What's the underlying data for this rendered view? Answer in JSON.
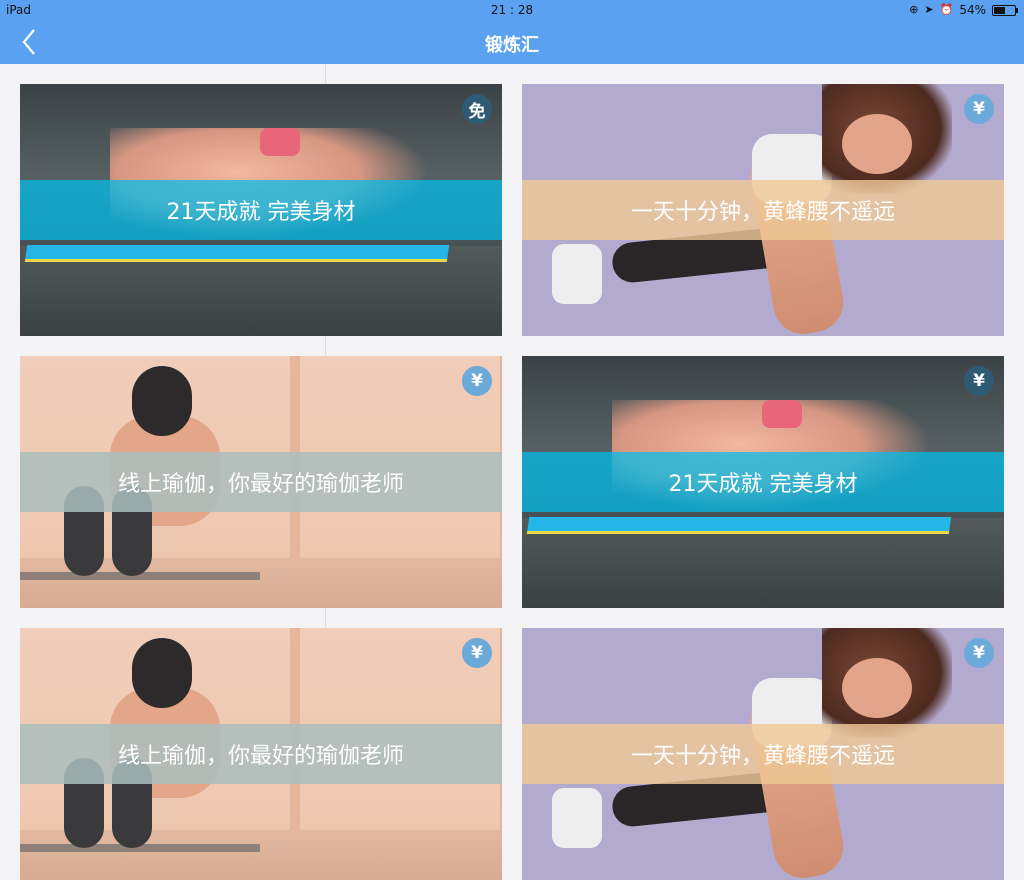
{
  "status_bar": {
    "device": "iPad",
    "time": "21 : 28",
    "battery": "54%",
    "battery_level": 0.54
  },
  "navbar": {
    "title": "锻炼汇",
    "back_icon": "chevron-left-icon"
  },
  "colors": {
    "nav_background": "#5aa1f2",
    "page_background": "#f3f3f5"
  },
  "cards": [
    {
      "title": "21天成就 完美身材",
      "badge": "免"
    },
    {
      "title": "一天十分钟，黄蜂腰不遥远",
      "badge": "¥"
    },
    {
      "title": "线上瑜伽，你最好的瑜伽老师",
      "badge": "¥"
    },
    {
      "title": "21天成就 完美身材",
      "badge": "¥"
    },
    {
      "title": "线上瑜伽，你最好的瑜伽老师",
      "badge": "¥"
    },
    {
      "title": "一天十分钟，黄蜂腰不遥远",
      "badge": "¥"
    }
  ]
}
